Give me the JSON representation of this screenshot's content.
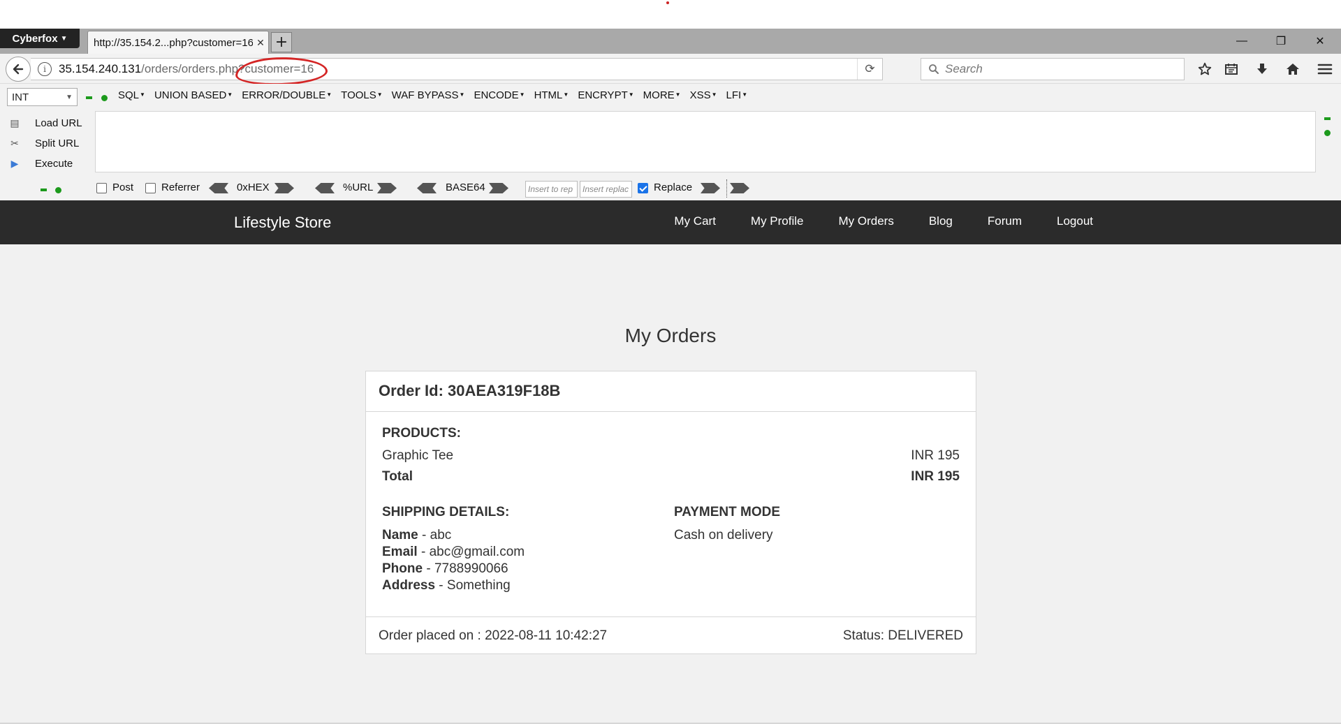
{
  "browser": {
    "brand": "Cyberfox",
    "tab_title": "http://35.154.2...php?customer=16",
    "url_host": "35.154.240.131",
    "url_path": "/orders/orders.php?customer=16",
    "search_placeholder": "Search"
  },
  "hackbar": {
    "select_value": "INT",
    "menus": [
      "SQL",
      "UNION BASED",
      "ERROR/DOUBLE",
      "TOOLS",
      "WAF BYPASS",
      "ENCODE",
      "HTML",
      "ENCRYPT",
      "MORE",
      "XSS",
      "LFI"
    ],
    "actions": [
      "Load URL",
      "Split URL",
      "Execute"
    ],
    "post_label": "Post",
    "referrer_label": "Referrer",
    "hex_label": "0xHEX",
    "url_label": "%URL",
    "base64_label": "BASE64",
    "insert_to_placeholder": "Insert to rep",
    "insert_replace_placeholder": "Insert replac",
    "replace_label": "Replace",
    "replace_checked": true
  },
  "site": {
    "brand": "Lifestyle Store",
    "nav": [
      "My Cart",
      "My Profile",
      "My Orders",
      "Blog",
      "Forum",
      "Logout"
    ]
  },
  "page": {
    "title": "My Orders",
    "order_id_label": "Order Id: 30AEA319F18B",
    "products_title": "PRODUCTS:",
    "product_name": "Graphic Tee",
    "product_price": "INR 195",
    "total_label": "Total",
    "total_value": "INR 195",
    "shipping_title": "SHIPPING DETAILS:",
    "name_label": "Name",
    "name_value": " - abc",
    "email_label": "Email",
    "email_value": " - abc@gmail.com",
    "phone_label": "Phone",
    "phone_value": " - 7788990066",
    "address_label": "Address",
    "address_value": " - Something",
    "payment_title": "PAYMENT MODE",
    "payment_value": "Cash on delivery",
    "placed_on": "Order placed on : 2022-08-11 10:42:27",
    "status": "Status: DELIVERED"
  },
  "colors": {
    "site_nav_bg": "#2b2b2b",
    "annotation": "#d42525",
    "check_blue": "#1a73e8"
  }
}
